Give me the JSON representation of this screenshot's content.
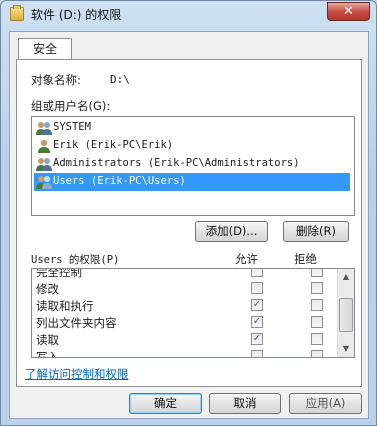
{
  "window": {
    "title": "软件 (D:) 的权限",
    "close_glyph": "✕"
  },
  "tabs": [
    {
      "label": "安全"
    }
  ],
  "object": {
    "label": "对象名称:",
    "value": "D:\\"
  },
  "groups": {
    "label": "组或用户名(G):",
    "items": [
      {
        "name": "SYSTEM",
        "icon": "users-group-icon",
        "selected": false
      },
      {
        "name": "Erik (Erik-PC\\Erik)",
        "icon": "user-icon",
        "selected": false
      },
      {
        "name": "Administrators (Erik-PC\\Administrators)",
        "icon": "users-group-icon",
        "selected": false
      },
      {
        "name": "Users (Erik-PC\\Users)",
        "icon": "users-group-icon",
        "selected": true
      }
    ]
  },
  "buttons": {
    "add": "添加(D)...",
    "remove": "删除(R)"
  },
  "permissions": {
    "label": "Users 的权限(P)",
    "allow_header": "允许",
    "deny_header": "拒绝",
    "rows": [
      {
        "name": "完全控制",
        "allow": false,
        "deny": false
      },
      {
        "name": "修改",
        "allow": false,
        "deny": false
      },
      {
        "name": "读取和执行",
        "allow": true,
        "deny": false
      },
      {
        "name": "列出文件夹内容",
        "allow": true,
        "deny": false
      },
      {
        "name": "读取",
        "allow": true,
        "deny": false
      },
      {
        "name": "写入",
        "allow": false,
        "deny": false
      }
    ]
  },
  "link": "了解访问控制和权限",
  "footer": {
    "ok": "确定",
    "cancel": "取消",
    "apply": "应用(A)"
  },
  "colors": {
    "selection": "#3399ff",
    "link": "#0066cc"
  }
}
